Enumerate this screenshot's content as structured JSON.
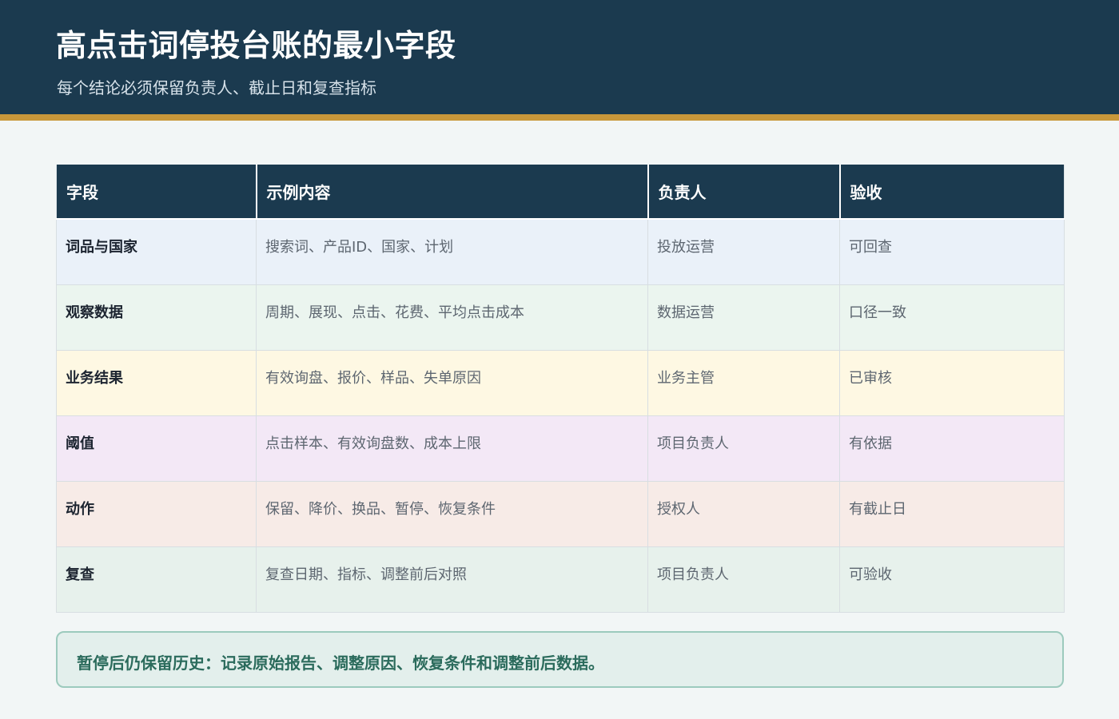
{
  "header": {
    "title": "高点击词停投台账的最小字段",
    "subtitle": "每个结论必须保留负责人、截止日和复查指标"
  },
  "table": {
    "columns": [
      "字段",
      "示例内容",
      "负责人",
      "验收"
    ],
    "rows": [
      [
        "词品与国家",
        "搜索词、产品ID、国家、计划",
        "投放运营",
        "可回查"
      ],
      [
        "观察数据",
        "周期、展现、点击、花费、平均点击成本",
        "数据运营",
        "口径一致"
      ],
      [
        "业务结果",
        "有效询盘、报价、样品、失单原因",
        "业务主管",
        "已审核"
      ],
      [
        "阈值",
        "点击样本、有效询盘数、成本上限",
        "项目负责人",
        "有依据"
      ],
      [
        "动作",
        "保留、降价、换品、暂停、恢复条件",
        "授权人",
        "有截止日"
      ],
      [
        "复查",
        "复查日期、指标、调整前后对照",
        "项目负责人",
        "可验收"
      ]
    ]
  },
  "callout": {
    "text": "暂停后仍保留历史：记录原始报告、调整原因、恢复条件和调整前后数据。"
  },
  "colors": {
    "header_bg": "#1b3a4f",
    "accent_bar": "#c9973a",
    "callout_text": "#2b6b5c"
  }
}
